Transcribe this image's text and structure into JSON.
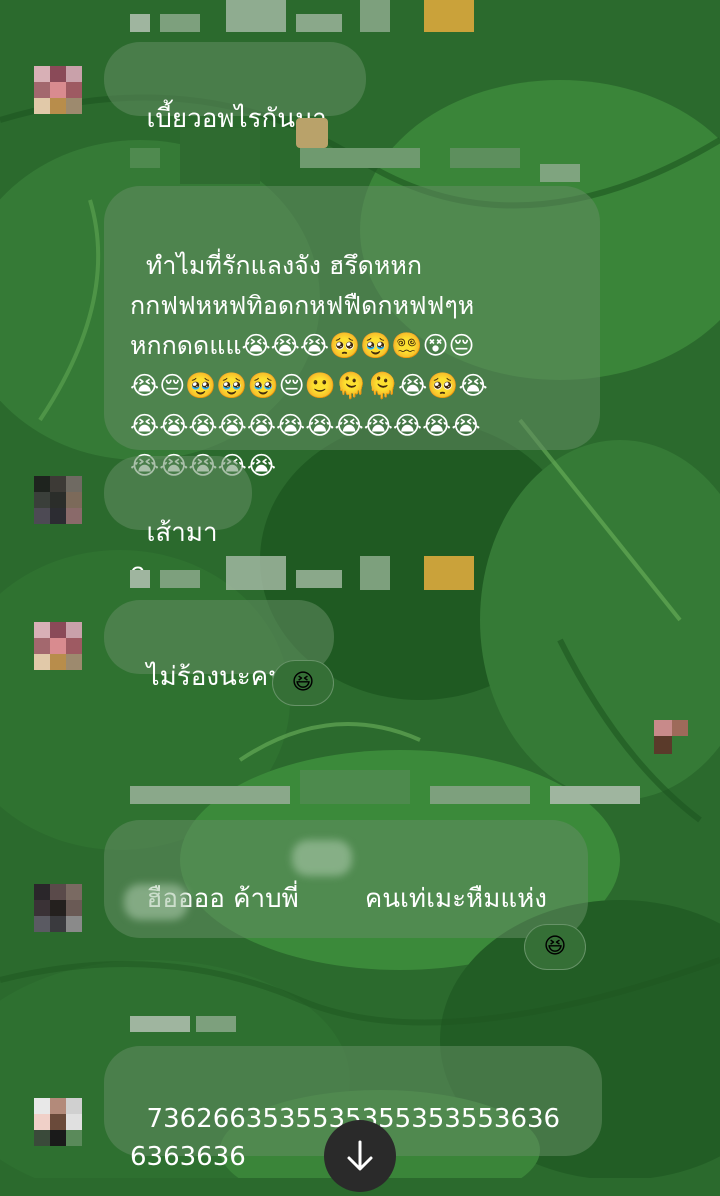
{
  "messages": [
    {
      "text": "เบี้ยวอพไรกันมา"
    },
    {
      "text": "ทำไมที่รักแลงจัง ฮรึดหหก\nกกฟฟหหฟทิอดกหฟฟืดกหฟฟๆห\nหกกดดแแ😭😭😭🥺🥹😵‍💫😵😔\n😭😔🥹🥹🥹😔🙂🫠🫠😭🥺😭\n😭😭😭😭😭😭😭😭😭😭😭😭\n😭😭😭😭😭"
    },
    {
      "text": "เส้ามาก"
    },
    {
      "text": "ไม่ร้องนะคนดี",
      "reaction": "😆"
    },
    {
      "text": "ฮืออออ ค้าบพี่        คนเท่เมะหืมแห่ง\n",
      "reaction": "😆"
    },
    {
      "text": "7362663535535355353553636\n6363636"
    }
  ],
  "icons": {
    "scroll_down": "arrow-down-icon"
  },
  "colors": {
    "background": "#2b6a2d",
    "bubble": "#5f8a5f",
    "scroll_button": "#2a2a2a"
  }
}
